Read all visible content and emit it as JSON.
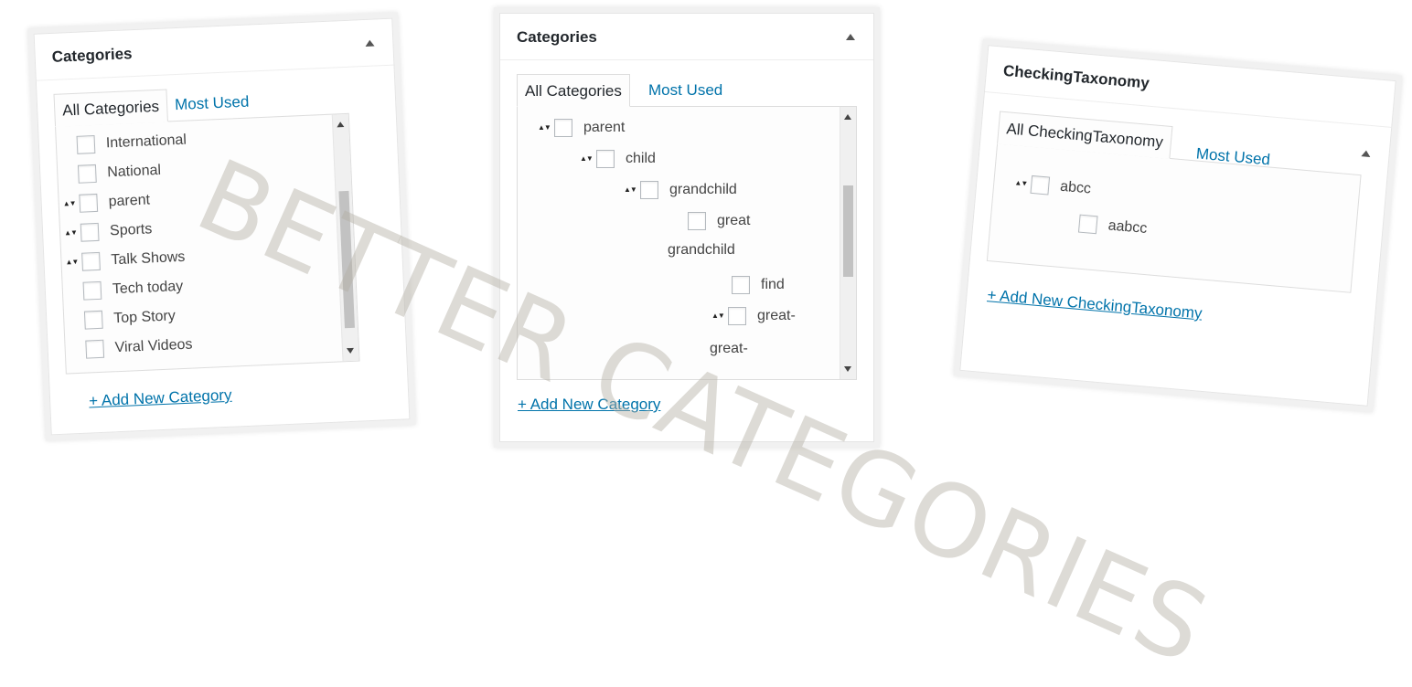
{
  "watermark": "BETTER CATEGORIES",
  "left_panel": {
    "title": "Categories",
    "tabs": [
      "All Categories",
      "Most Used"
    ],
    "items": [
      {
        "label": "International",
        "arrows": false
      },
      {
        "label": "National",
        "arrows": false
      },
      {
        "label": "parent",
        "arrows": true
      },
      {
        "label": "Sports",
        "arrows": true
      },
      {
        "label": "Talk Shows",
        "arrows": true
      },
      {
        "label": "Tech today",
        "arrows": false
      },
      {
        "label": "Top Story",
        "arrows": false
      },
      {
        "label": "Viral Videos",
        "arrows": false
      }
    ],
    "add_link": "+ Add New Category"
  },
  "middle_panel": {
    "title": "Categories",
    "tabs": [
      "All Categories",
      "Most Used"
    ],
    "items": [
      {
        "label": "parent",
        "arrows": true
      },
      {
        "label": "child",
        "arrows": true
      },
      {
        "label": "grandchild",
        "arrows": true
      },
      {
        "label": "great",
        "arrows": false
      },
      {
        "label": "grandchild",
        "arrows": false
      },
      {
        "label": "find",
        "arrows": false
      },
      {
        "label": "great-",
        "arrows": true
      },
      {
        "label": "great-",
        "arrows": false
      }
    ],
    "add_link": "+ Add New Category"
  },
  "right_panel": {
    "title": "CheckingTaxonomy",
    "tabs": [
      "All CheckingTaxonomy",
      "Most Used"
    ],
    "items": [
      {
        "label": "abcc",
        "arrows": true
      },
      {
        "label": "aabcc",
        "arrows": false
      }
    ],
    "add_link": "+ Add New CheckingTaxonomy"
  },
  "colors": {
    "link": "#0073aa",
    "frame": "#f1f1f1",
    "border": "#dddddd",
    "watermark": "#b4afa5"
  }
}
